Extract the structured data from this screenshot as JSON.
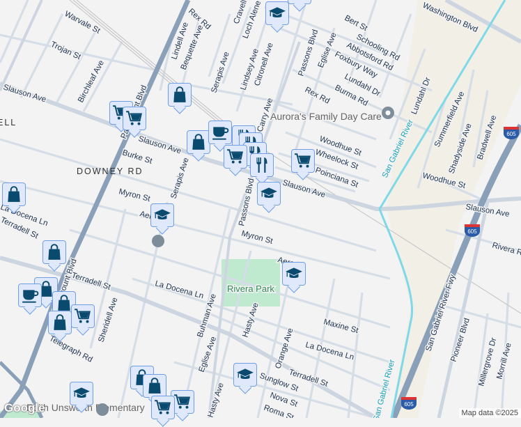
{
  "map": {
    "area_labels": [
      "DOWNEY RD",
      "ELL"
    ],
    "poi": "Aurora's Family Day Care",
    "park": "Rivera Park",
    "river": [
      "San Gabriel River",
      "San Gabriel River"
    ],
    "highway_shield": "605",
    "streets": {
      "warvale": "Warvale St",
      "trojan": "Trojan St",
      "birchleaf": "Birchleaf Ave",
      "slauson1": "Slauson Ave",
      "slauson2": "Slauson Ave",
      "slauson3": "Slauson Ave",
      "slauson4": "Slauson Ave",
      "paramount1": "Paramount Blvd",
      "paramount2": "Paramount Blvd",
      "burke": "Burke St",
      "myron1": "Myron St",
      "myron2": "Myron St",
      "serapis1": "Serapis Ave",
      "serapis2": "Serapis Ave",
      "rex1": "Rex Rd",
      "rex2": "Rex Rd",
      "lindell": "Lindell Ave",
      "bequette": "Bequette Ave",
      "cravell": "Cravell Ave",
      "lochalene": "Loch Alene Ave",
      "lindsey": "Lindsey Ave",
      "citronell": "Citronell Ave",
      "carry": "Carry Ave",
      "passons1": "Passons Blvd",
      "passons2": "Passons Blvd",
      "bert": "Bert St",
      "schooling": "Schooling Rd",
      "abbotsford": "Abbotsford Rd",
      "eglise1": "Eglise Ave",
      "foxbury": "Foxbury Way",
      "lundahl1": "Lundahl Dr",
      "lundahl2": "Lundahl Dr",
      "burma": "Burma Rd",
      "woodhue1": "Woodhue St",
      "woodhue2": "Woodhue St",
      "wheelock": "Wheelock St",
      "poinciana": "Poinciana St",
      "summerfield": "Summerfield Ave",
      "shadyside": "Shadyside Ave",
      "bradwell": "Bradwell Ave",
      "washington": "Washington Blvd",
      "aero1": "Aero St",
      "aero2": "Aero Ln",
      "docena1": "La Docena Ln",
      "docena2": "La Docena Ln",
      "docena3": "La Docena Ln",
      "terradell1": "Terradell St",
      "terradell2": "Terradell St",
      "terradell3": "Terradell St",
      "sheridell": "Sheridell Ave",
      "telegraph": "Telegraph Rd",
      "buhman": "Buhman Ave",
      "eglise2": "Eglise Ave",
      "hasty1": "Hasty Ave",
      "hasty2": "Hasty Ave",
      "maxine": "Maxine St",
      "orange": "Orange Ave",
      "sunglow": "Sunglow St",
      "nova": "Nova St",
      "roma": "Roma St",
      "rivera": "Rivera Rd",
      "sgfwy": "San Gabriel River Fwy",
      "pioneer": "Pioneer Blvd",
      "millergrove": "Millergrove Dr",
      "morrill": "Morrill Ave"
    },
    "school": "Edith Unsworth Elementary"
  },
  "markers": [
    "graduation-cap",
    "graduation-cap",
    "shopping-bag",
    "shopping-cart",
    "shopping-cart",
    "shopping-bag",
    "coffee",
    "fork-knife",
    "fork-knife",
    "fork-knife",
    "shopping-cart",
    "fork-knife",
    "shopping-cart",
    "graduation-cap",
    "graduation-cap",
    "shopping-bag",
    "shopping-bag",
    "shopping-bag",
    "coffee",
    "shopping-bag",
    "shopping-cart",
    "shopping-bag",
    "graduation-cap",
    "graduation-cap",
    "graduation-cap",
    "shopping-bag",
    "shopping-bag",
    "shopping-cart",
    "shopping-cart"
  ],
  "footer": {
    "logo": "Google",
    "attribution": "Map data ©2025"
  },
  "colors": {
    "background": "#f4f3f4",
    "road": "#d5dde6",
    "freeway": "#8aa0b8",
    "river": "#7fd8e8",
    "park": "#bfead0",
    "marker_fill": "#dfe9fb",
    "icon": "#0b4a6f"
  }
}
